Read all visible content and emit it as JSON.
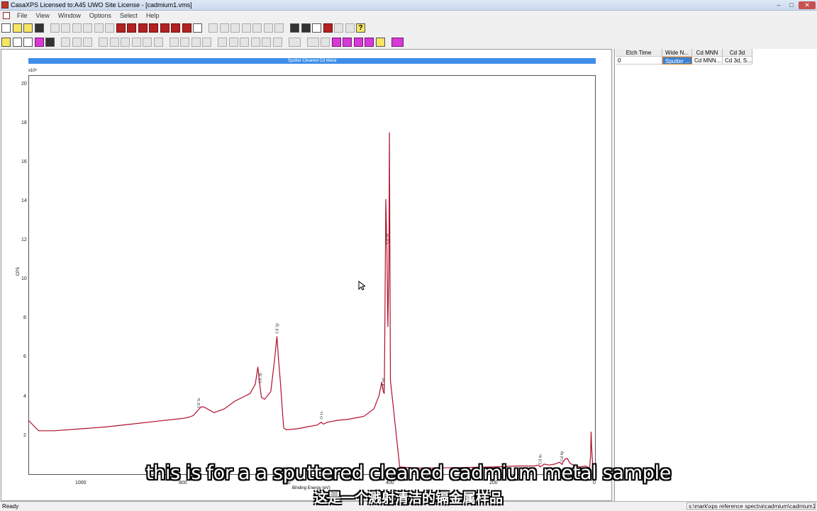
{
  "window": {
    "title": "CasaXPS Licensed to:A45 UWO Site License - [cadmium1.vms]",
    "controls": [
      "–",
      "□",
      "✕"
    ]
  },
  "menu": [
    "File",
    "View",
    "Window",
    "Options",
    "Select",
    "Help"
  ],
  "plot": {
    "title": "Sputter Cleaned Cd Metal",
    "y_exponent": "x10⁵",
    "y_label": "CPS",
    "x_label": "Binding Energy (eV)",
    "y_ticks": [
      "20",
      "18",
      "16",
      "14",
      "12",
      "10",
      "8",
      "6",
      "4",
      "2"
    ],
    "x_ticks": [
      "1000",
      "800",
      "600",
      "400",
      "200",
      "0"
    ],
    "peak_labels": [
      "Cd 3d",
      "Cd 3d",
      "Cd 3p",
      "Cd 3p",
      "Cd 3s",
      "O 1s",
      "Cd 4s",
      "Cd 4p"
    ],
    "line_color": "#b0102c"
  },
  "chart_data": {
    "type": "line",
    "title": "Sputter Cleaned Cd Metal",
    "xlabel": "Binding Energy (eV)",
    "ylabel": "CPS",
    "xlim": [
      1100,
      0
    ],
    "ylim": [
      0,
      21
    ],
    "x": [
      1100,
      1080,
      1050,
      1000,
      950,
      900,
      850,
      800,
      790,
      780,
      772,
      765,
      760,
      740,
      720,
      700,
      670,
      660,
      655,
      651,
      648,
      642,
      630,
      623,
      618,
      615,
      611,
      608,
      605,
      600,
      580,
      560,
      540,
      532,
      528,
      520,
      500,
      480,
      450,
      430,
      420,
      415,
      412,
      410,
      409,
      407,
      405,
      403,
      401,
      400,
      398,
      380,
      350,
      300,
      200,
      150,
      120,
      110,
      108,
      105,
      100,
      90,
      80,
      70,
      66,
      65,
      64,
      62,
      60,
      55,
      50,
      40,
      30,
      20,
      12,
      10,
      9,
      8,
      6,
      4,
      0
    ],
    "y": [
      2.9,
      2.35,
      2.35,
      2.45,
      2.55,
      2.7,
      2.85,
      3.0,
      3.05,
      3.15,
      3.4,
      3.6,
      3.6,
      3.3,
      3.5,
      3.9,
      4.3,
      4.8,
      5.7,
      4.7,
      4.1,
      4.0,
      4.4,
      6.0,
      7.3,
      6.1,
      4.8,
      3.6,
      2.5,
      2.4,
      2.45,
      2.55,
      2.65,
      2.8,
      2.7,
      2.8,
      2.9,
      2.95,
      3.1,
      3.5,
      4.2,
      4.9,
      4.4,
      4.3,
      7.0,
      14.5,
      12.0,
      7.8,
      11.2,
      18.0,
      5.0,
      0.45,
      0.4,
      0.4,
      0.45,
      0.5,
      0.5,
      0.55,
      0.45,
      0.5,
      0.6,
      0.55,
      0.6,
      0.7,
      0.6,
      0.58,
      0.7,
      0.75,
      0.85,
      0.9,
      0.65,
      0.5,
      0.45,
      0.5,
      0.4,
      1.0,
      2.3,
      1.5,
      0.6,
      0.2,
      0.4
    ],
    "peaks": [
      {
        "label": "Cd 3d",
        "x": 405
      },
      {
        "label": "Cd 3d",
        "x": 412
      },
      {
        "label": "Cd 3p",
        "x": 618
      },
      {
        "label": "Cd 3p",
        "x": 651
      },
      {
        "label": "Cd 3s",
        "x": 770
      },
      {
        "label": "O 1s",
        "x": 532
      },
      {
        "label": "Cd 4s",
        "x": 108
      },
      {
        "label": "Cd 4p",
        "x": 66
      }
    ]
  },
  "table": {
    "headers": [
      "Etch Time",
      "Wide N...",
      "Cd MNN",
      "Cd 3d"
    ],
    "rows": [
      [
        "0",
        "Sputter ...",
        "Cd MNN...",
        "Cd 3d, S..."
      ]
    ]
  },
  "status": {
    "left": "Ready",
    "path": "s:\\mark\\xps reference spectra\\cadmium\\cadmium1"
  },
  "subtitles": {
    "english": "this is for a a sputtered cleaned cadmium metal sample",
    "chinese": "这是一个溅射清洁的镉金属样品"
  }
}
